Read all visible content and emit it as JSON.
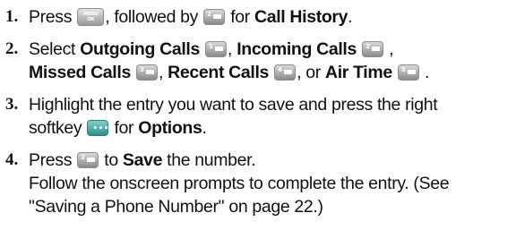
{
  "steps": [
    {
      "num": "1.",
      "t1": "Press",
      "t2": ", followed by",
      "t3": "for",
      "call_history": "Call History",
      "t4": ".",
      "menu_key": {
        "icon": "menu-ok-key-icon",
        "top": "MENU",
        "bottom": "OK"
      },
      "key2": {
        "icon": "key-2-icon",
        "label": "2"
      }
    },
    {
      "num": "2.",
      "t1": "Select",
      "outgoing": "Outgoing Calls",
      "sep1": ",",
      "incoming": "Incoming Calls",
      "sep2": ",",
      "missed": "Missed Calls",
      "sep3": ",",
      "recent": "Recent Calls",
      "sep4": ", or",
      "airtime": "Air Time",
      "end": ".",
      "key1": {
        "icon": "key-1-icon",
        "label": "1"
      },
      "key2": {
        "icon": "key-2-icon",
        "label": "2"
      },
      "key3": {
        "icon": "key-3-icon",
        "label": "3"
      },
      "key4": {
        "icon": "key-4-icon",
        "label": "4"
      },
      "key5": {
        "icon": "key-5-icon",
        "label": "5"
      }
    },
    {
      "num": "3.",
      "t1": "Highlight the entry you want to save and press the right",
      "t2": "softkey",
      "t3": "for",
      "options": "Options",
      "t4": ".",
      "opt_key": {
        "icon": "options-softkey-icon",
        "label": "•••"
      }
    },
    {
      "num": "4.",
      "t1": "Press",
      "t2": "to",
      "save": "Save",
      "t3": "the number.",
      "t4": "Follow the onscreen prompts to complete the entry. (See",
      "t5": "\"Saving a Phone Number\" on page 22.)",
      "key2": {
        "icon": "key-2-icon",
        "label": "2"
      }
    }
  ]
}
